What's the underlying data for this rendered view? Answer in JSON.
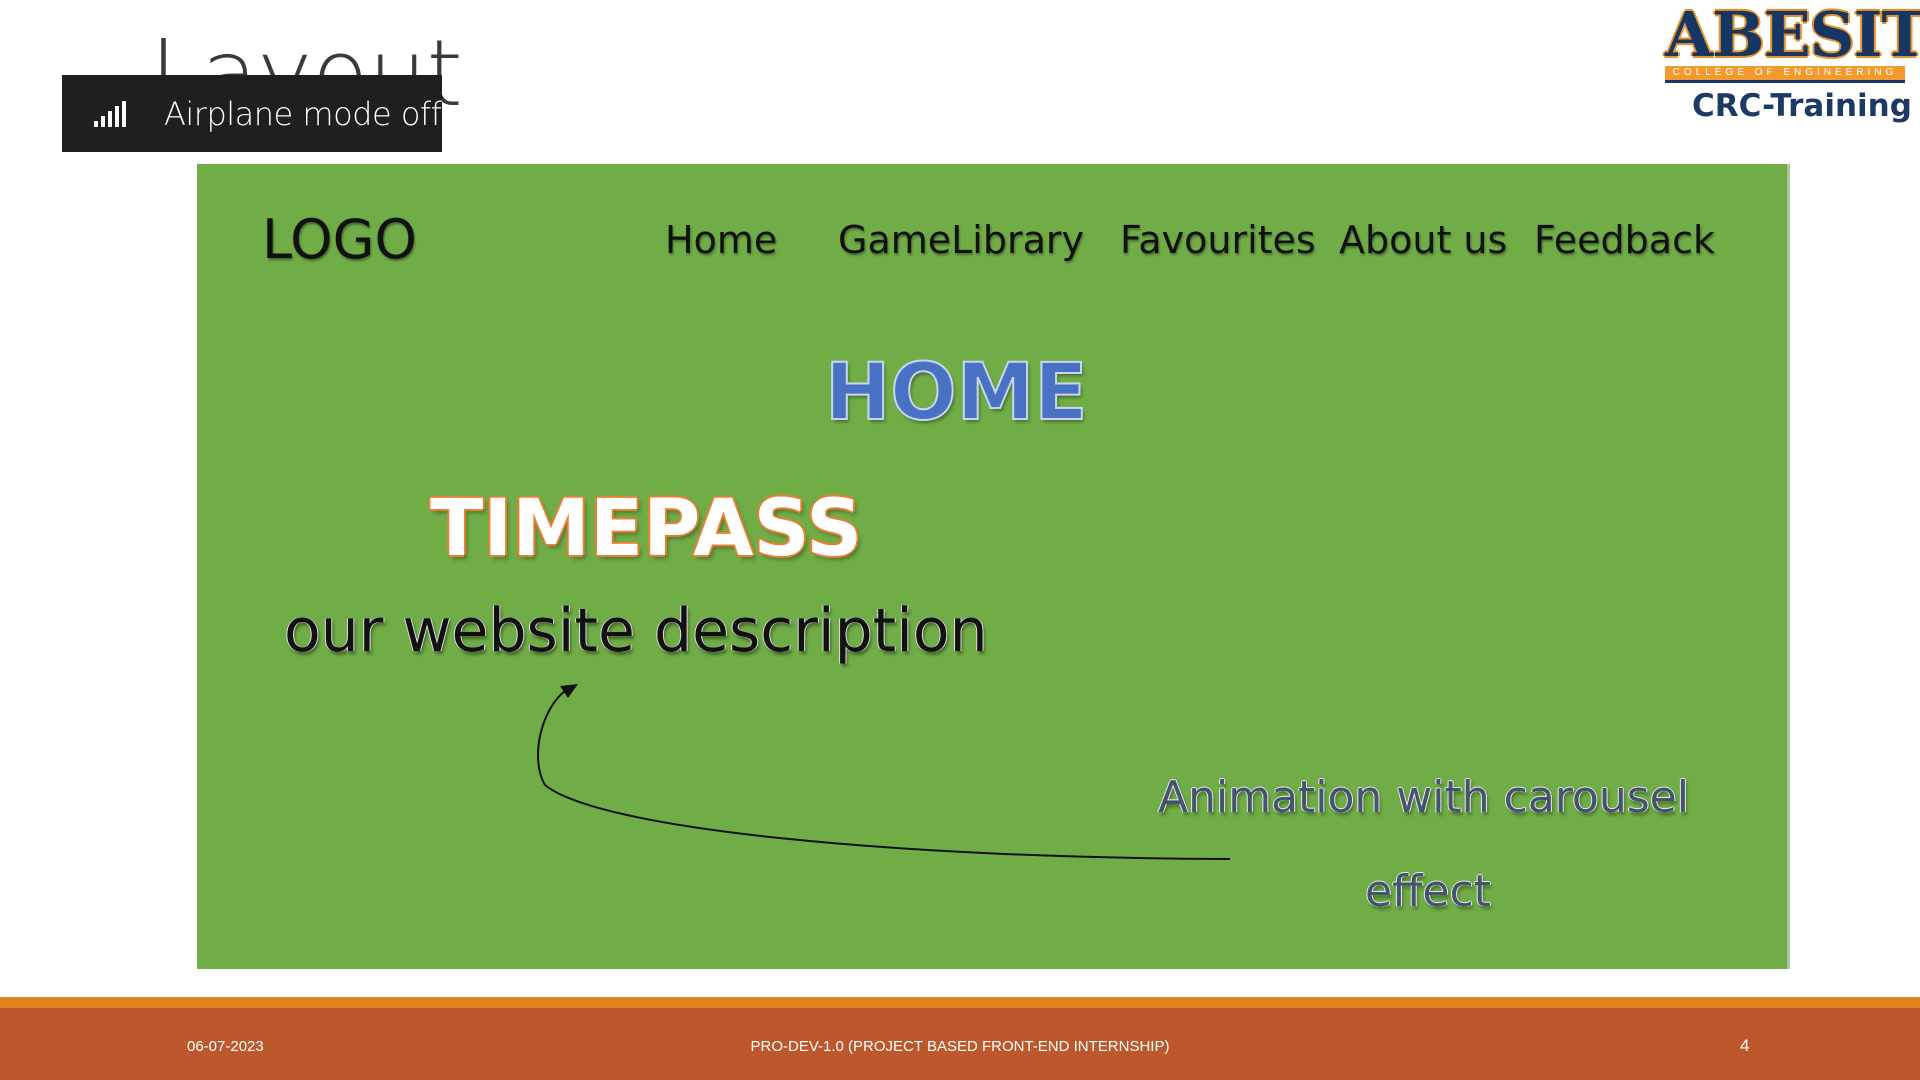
{
  "slide": {
    "title": "Layout",
    "logo_main": "ABESIT",
    "logo_sub": "COLLEGE OF ENGINEERING",
    "logo_caption": "CRC-Training"
  },
  "toast": {
    "icon": "signal-bars-icon",
    "text": "Airplane mode off"
  },
  "mockup": {
    "logo": "LOGO",
    "nav": [
      "Home",
      "GameLibrary",
      "Favourites",
      "About us",
      "Feedback"
    ],
    "page_heading": "HOME",
    "brand": "TIMEPASS",
    "description": "our website description",
    "annotation_line1": "Animation with carousel",
    "annotation_line2": "effect",
    "colors": {
      "background": "#70ad47",
      "heading": "#4a72c4",
      "brand_outline": "#ed7d31"
    }
  },
  "footer": {
    "date": "06-07-2023",
    "title": "PRO-DEV-1.0 (PROJECT BASED FRONT-END INTERNSHIP)",
    "page": "4",
    "color": "#bd582c",
    "stripe_color": "#e3831f"
  }
}
